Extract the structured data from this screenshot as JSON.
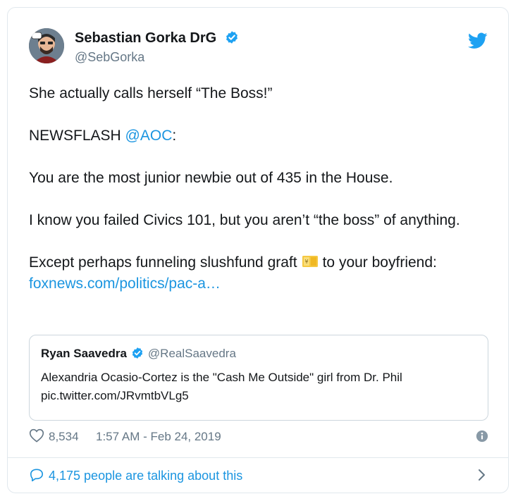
{
  "user": {
    "display_name": "Sebastian Gorka DrG",
    "handle": "@SebGorka"
  },
  "tweet": {
    "line1": "She actually calls herself “The Boss!”",
    "newsflash_prefix": "NEWSFLASH ",
    "newsflash_mention": "@AOC",
    "newsflash_suffix": ":",
    "line3": "You are the most junior newbie out of 435 in the House.",
    "line4": "I know you failed Civics 101, but you aren’t “the boss” of anything.",
    "line5_before": "Except perhaps funneling slushfund graft",
    "line5_after": "to your boyfriend:",
    "link": "foxnews.com/politics/pac-a…"
  },
  "quote": {
    "name": "Ryan Saavedra",
    "handle": "@RealSaavedra",
    "text": "Alexandria Ocasio-Cortez is the \"Cash Me Outside\" girl from Dr. Phil",
    "media_link": "pic.twitter.com/JRvmtbVLg5"
  },
  "meta": {
    "likes": "8,534",
    "timestamp": "1:57 AM - Feb 24, 2019"
  },
  "footer": {
    "talking_label": "4,175 people are talking about this"
  },
  "icons": {
    "brand": "twitter-bird-icon",
    "verified": "verified-badge-icon",
    "like": "heart-icon",
    "info": "info-icon",
    "reply": "chat-bubble-icon",
    "expand": "chevron-right-icon",
    "emoji": "cash-emoji-icon"
  },
  "colors": {
    "accent": "#1da1f2",
    "link": "#1b95e0",
    "secondary_text": "#657786",
    "border": "#e1e8ed"
  }
}
